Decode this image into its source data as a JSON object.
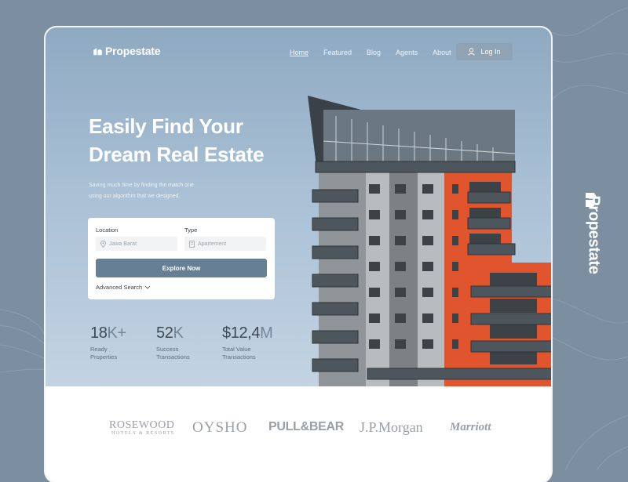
{
  "brand": {
    "name": "Propestate"
  },
  "nav": {
    "items": [
      {
        "label": "Home",
        "active": true
      },
      {
        "label": "Featured",
        "active": false
      },
      {
        "label": "Blog",
        "active": false
      },
      {
        "label": "Agents",
        "active": false
      },
      {
        "label": "About",
        "active": false
      }
    ],
    "login_label": "Log In"
  },
  "hero": {
    "headline_line1": "Easily Find Your",
    "headline_line2": "Dream Real Estate",
    "subtext_line1": "Saving much time by finding the match one",
    "subtext_line2": "using our algorithm that we designed."
  },
  "search": {
    "location_label": "Location",
    "location_value": "Jawa Barat",
    "type_label": "Type",
    "type_value": "Apartement",
    "explore_label": "Explore Now",
    "advanced_label": "Advanced Search"
  },
  "stats": [
    {
      "value": "18",
      "suffix": "K+",
      "label_line1": "Ready",
      "label_line2": "Properties"
    },
    {
      "value": "52",
      "suffix": "K",
      "label_line1": "Success",
      "label_line2": "Transactions"
    },
    {
      "value": "$12,4",
      "suffix": "M",
      "label_line1": "Total Value",
      "label_line2": "Transactions"
    }
  ],
  "partners": {
    "rosewood": "ROSEWOOD",
    "rosewood_sub": "HOTELS & RESORTS",
    "oysho": "OYSHO",
    "pullbear": "PULL&BEAR",
    "jpmorgan": "J.P.Morgan",
    "marriott": "Marriott"
  },
  "colors": {
    "page_bg": "#7b8fa0",
    "hero_sky": "#a9c0d5",
    "accent": "#677f94",
    "building_orange": "#e0552e"
  },
  "icons": [
    "logo-mark-icon",
    "user-icon",
    "map-pin-icon",
    "building-icon",
    "chevron-down-icon"
  ]
}
